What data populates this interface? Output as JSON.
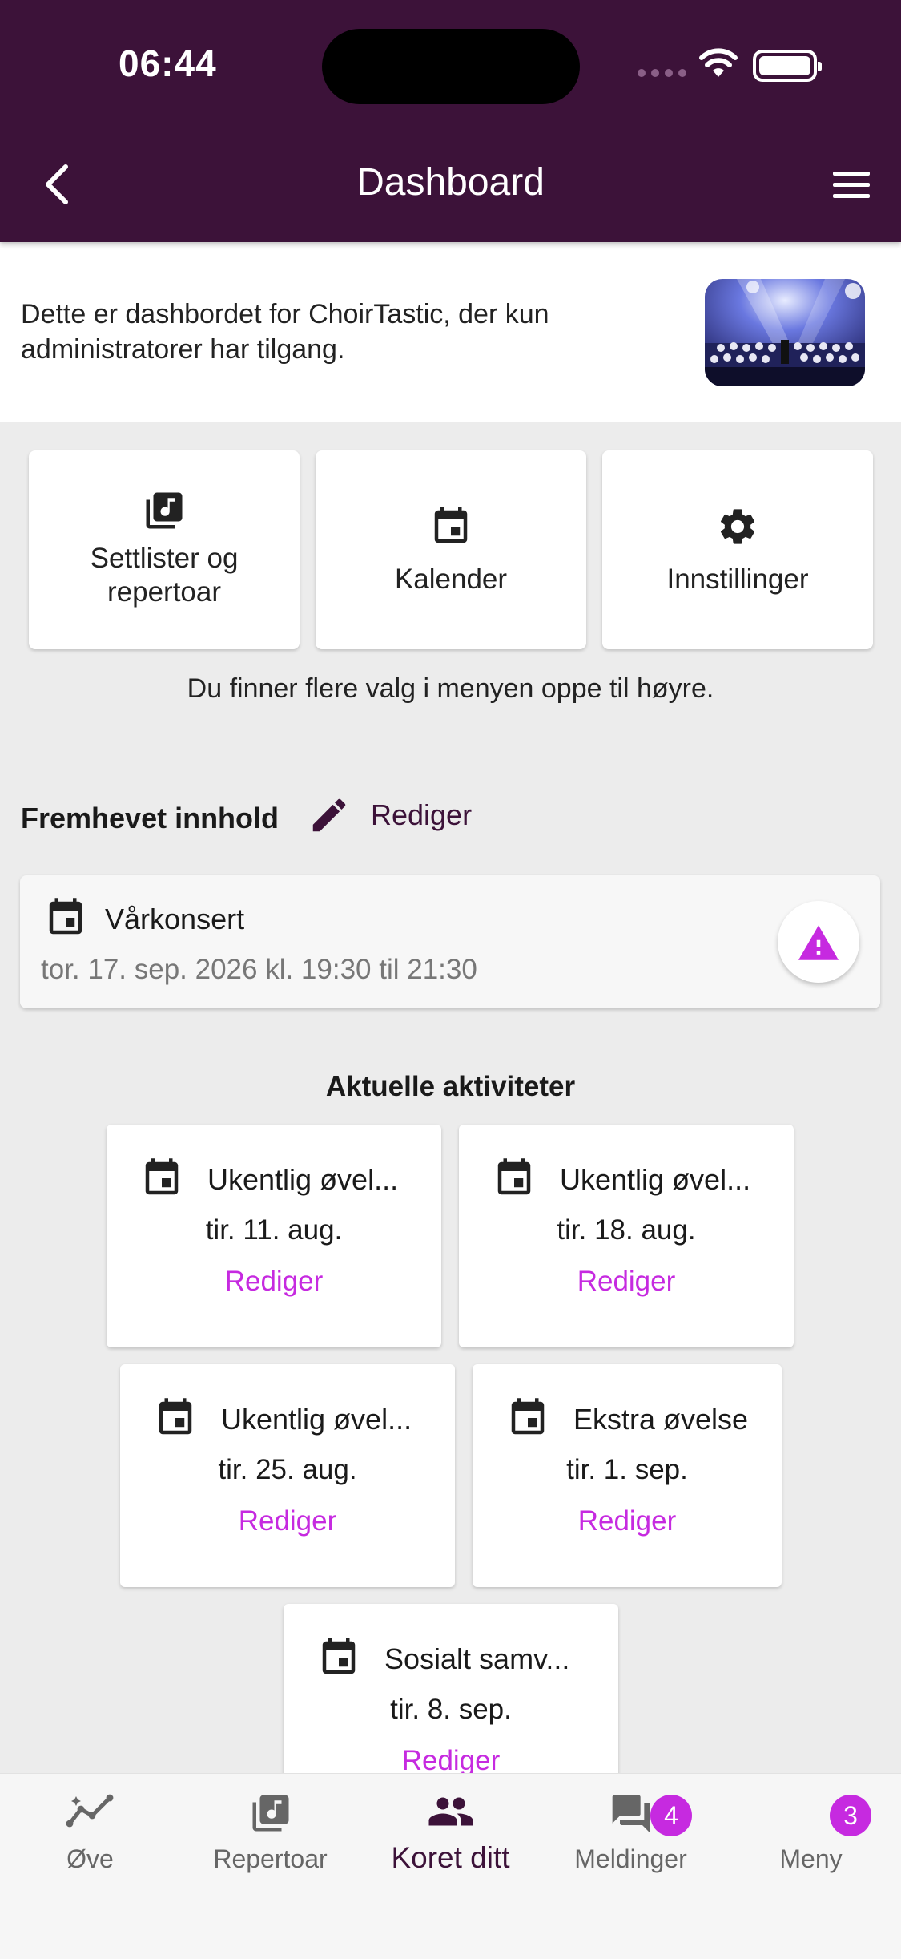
{
  "status_bar": {
    "time": "06:44"
  },
  "header": {
    "title": "Dashboard"
  },
  "intro": {
    "text": "Dette er dashbordet for ChoirTastic, der kun administratorer har tilgang."
  },
  "quick_links": [
    {
      "label": "Settlister og repertoar",
      "icon": "music-library-icon"
    },
    {
      "label": "Kalender",
      "icon": "calendar-icon"
    },
    {
      "label": "Innstillinger",
      "icon": "gear-icon"
    }
  ],
  "hint": "Du finner flere valg i menyen oppe til høyre.",
  "featured": {
    "title": "Fremhevet innhold",
    "edit_label": "Rediger",
    "event": {
      "name": "Vårkonsert",
      "date": "tor. 17. sep. 2026 kl. 19:30 til 21:30"
    }
  },
  "activities": {
    "title": "Aktuelle aktiviteter",
    "items": [
      {
        "name": "Ukentlig øvel...",
        "date": "tir. 11. aug.",
        "edit": "Rediger"
      },
      {
        "name": "Ukentlig øvel...",
        "date": "tir. 18. aug.",
        "edit": "Rediger"
      },
      {
        "name": "Ukentlig øvel...",
        "date": "tir. 25. aug.",
        "edit": "Rediger"
      },
      {
        "name": "Ekstra øvelse",
        "date": "tir. 1. sep.",
        "edit": "Rediger"
      },
      {
        "name": "Sosialt samv...",
        "date": "tir. 8. sep.",
        "edit": "Rediger"
      }
    ]
  },
  "tabs": [
    {
      "label": "Øve",
      "icon": "practice-chart-icon"
    },
    {
      "label": "Repertoar",
      "icon": "music-library-icon"
    },
    {
      "label": "Koret ditt",
      "icon": "group-icon",
      "active": true
    },
    {
      "label": "Meldinger",
      "icon": "chat-icon",
      "badge": "4"
    },
    {
      "label": "Meny",
      "icon": "avatar",
      "badge": "3"
    }
  ],
  "colors": {
    "header": "#3c1239",
    "accent": "#c62ae0",
    "background": "#ececec"
  }
}
